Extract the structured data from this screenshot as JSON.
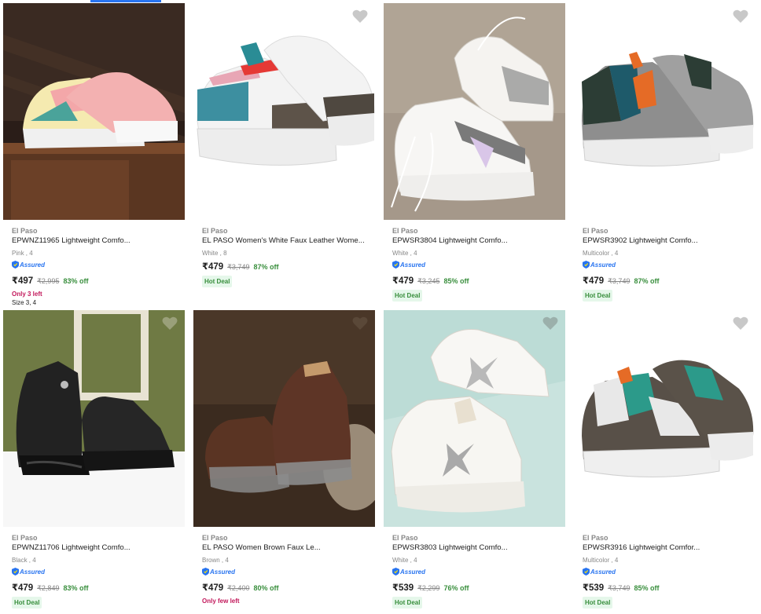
{
  "colors": {
    "accent": "#2874f0",
    "discount": "#388e3c",
    "stock_alert": "#c2185b",
    "hot_deal_bg": "#e5f7ea"
  },
  "assured_label": "Assured",
  "hot_deal_label": "Hot Deal",
  "products": [
    {
      "brand": "El Paso",
      "title": "EPWNZ11965 Lightweight Comfo...",
      "variant": "Pink , 4",
      "assured": true,
      "price": "₹497",
      "mrp": "₹2,995",
      "discount": "83% off",
      "stock": "Only 3 left",
      "hot_deal": false,
      "size": "Size 3, 4"
    },
    {
      "brand": "El Paso",
      "title": "EL PASO Women's White Faux Leather Wome...",
      "variant": "White , 8",
      "assured": false,
      "price": "₹479",
      "mrp": "₹3,749",
      "discount": "87% off",
      "stock": "",
      "hot_deal": true,
      "size": ""
    },
    {
      "brand": "El Paso",
      "title": "EPWSR3804 Lightweight Comfo...",
      "variant": "White , 4",
      "assured": true,
      "price": "₹479",
      "mrp": "₹3,245",
      "discount": "85% off",
      "stock": "",
      "hot_deal": true,
      "size": ""
    },
    {
      "brand": "El Paso",
      "title": "EPWSR3902 Lightweight Comfo...",
      "variant": "Multicolor , 4",
      "assured": true,
      "price": "₹479",
      "mrp": "₹3,749",
      "discount": "87% off",
      "stock": "",
      "hot_deal": true,
      "size": ""
    },
    {
      "brand": "El Paso",
      "title": "EPWNZ11706 Lightweight Comfo...",
      "variant": "Black , 4",
      "assured": true,
      "price": "₹479",
      "mrp": "₹2,849",
      "discount": "83% off",
      "stock": "",
      "hot_deal": true,
      "size": ""
    },
    {
      "brand": "El Paso",
      "title": "EL PASO Women Brown Faux Le...",
      "variant": "Brown , 4",
      "assured": true,
      "price": "₹479",
      "mrp": "₹2,400",
      "discount": "80% off",
      "stock": "Only few left",
      "hot_deal": false,
      "size": ""
    },
    {
      "brand": "El Paso",
      "title": "EPWSR3803 Lightweight Comfo...",
      "variant": "White , 4",
      "assured": true,
      "price": "₹539",
      "mrp": "₹2,299",
      "discount": "76% off",
      "stock": "",
      "hot_deal": true,
      "size": ""
    },
    {
      "brand": "El Paso",
      "title": "EPWSR3916 Lightweight Comfor...",
      "variant": "Multicolor , 4",
      "assured": true,
      "price": "₹539",
      "mrp": "₹3,749",
      "discount": "85% off",
      "stock": "",
      "hot_deal": true,
      "size": ""
    }
  ]
}
